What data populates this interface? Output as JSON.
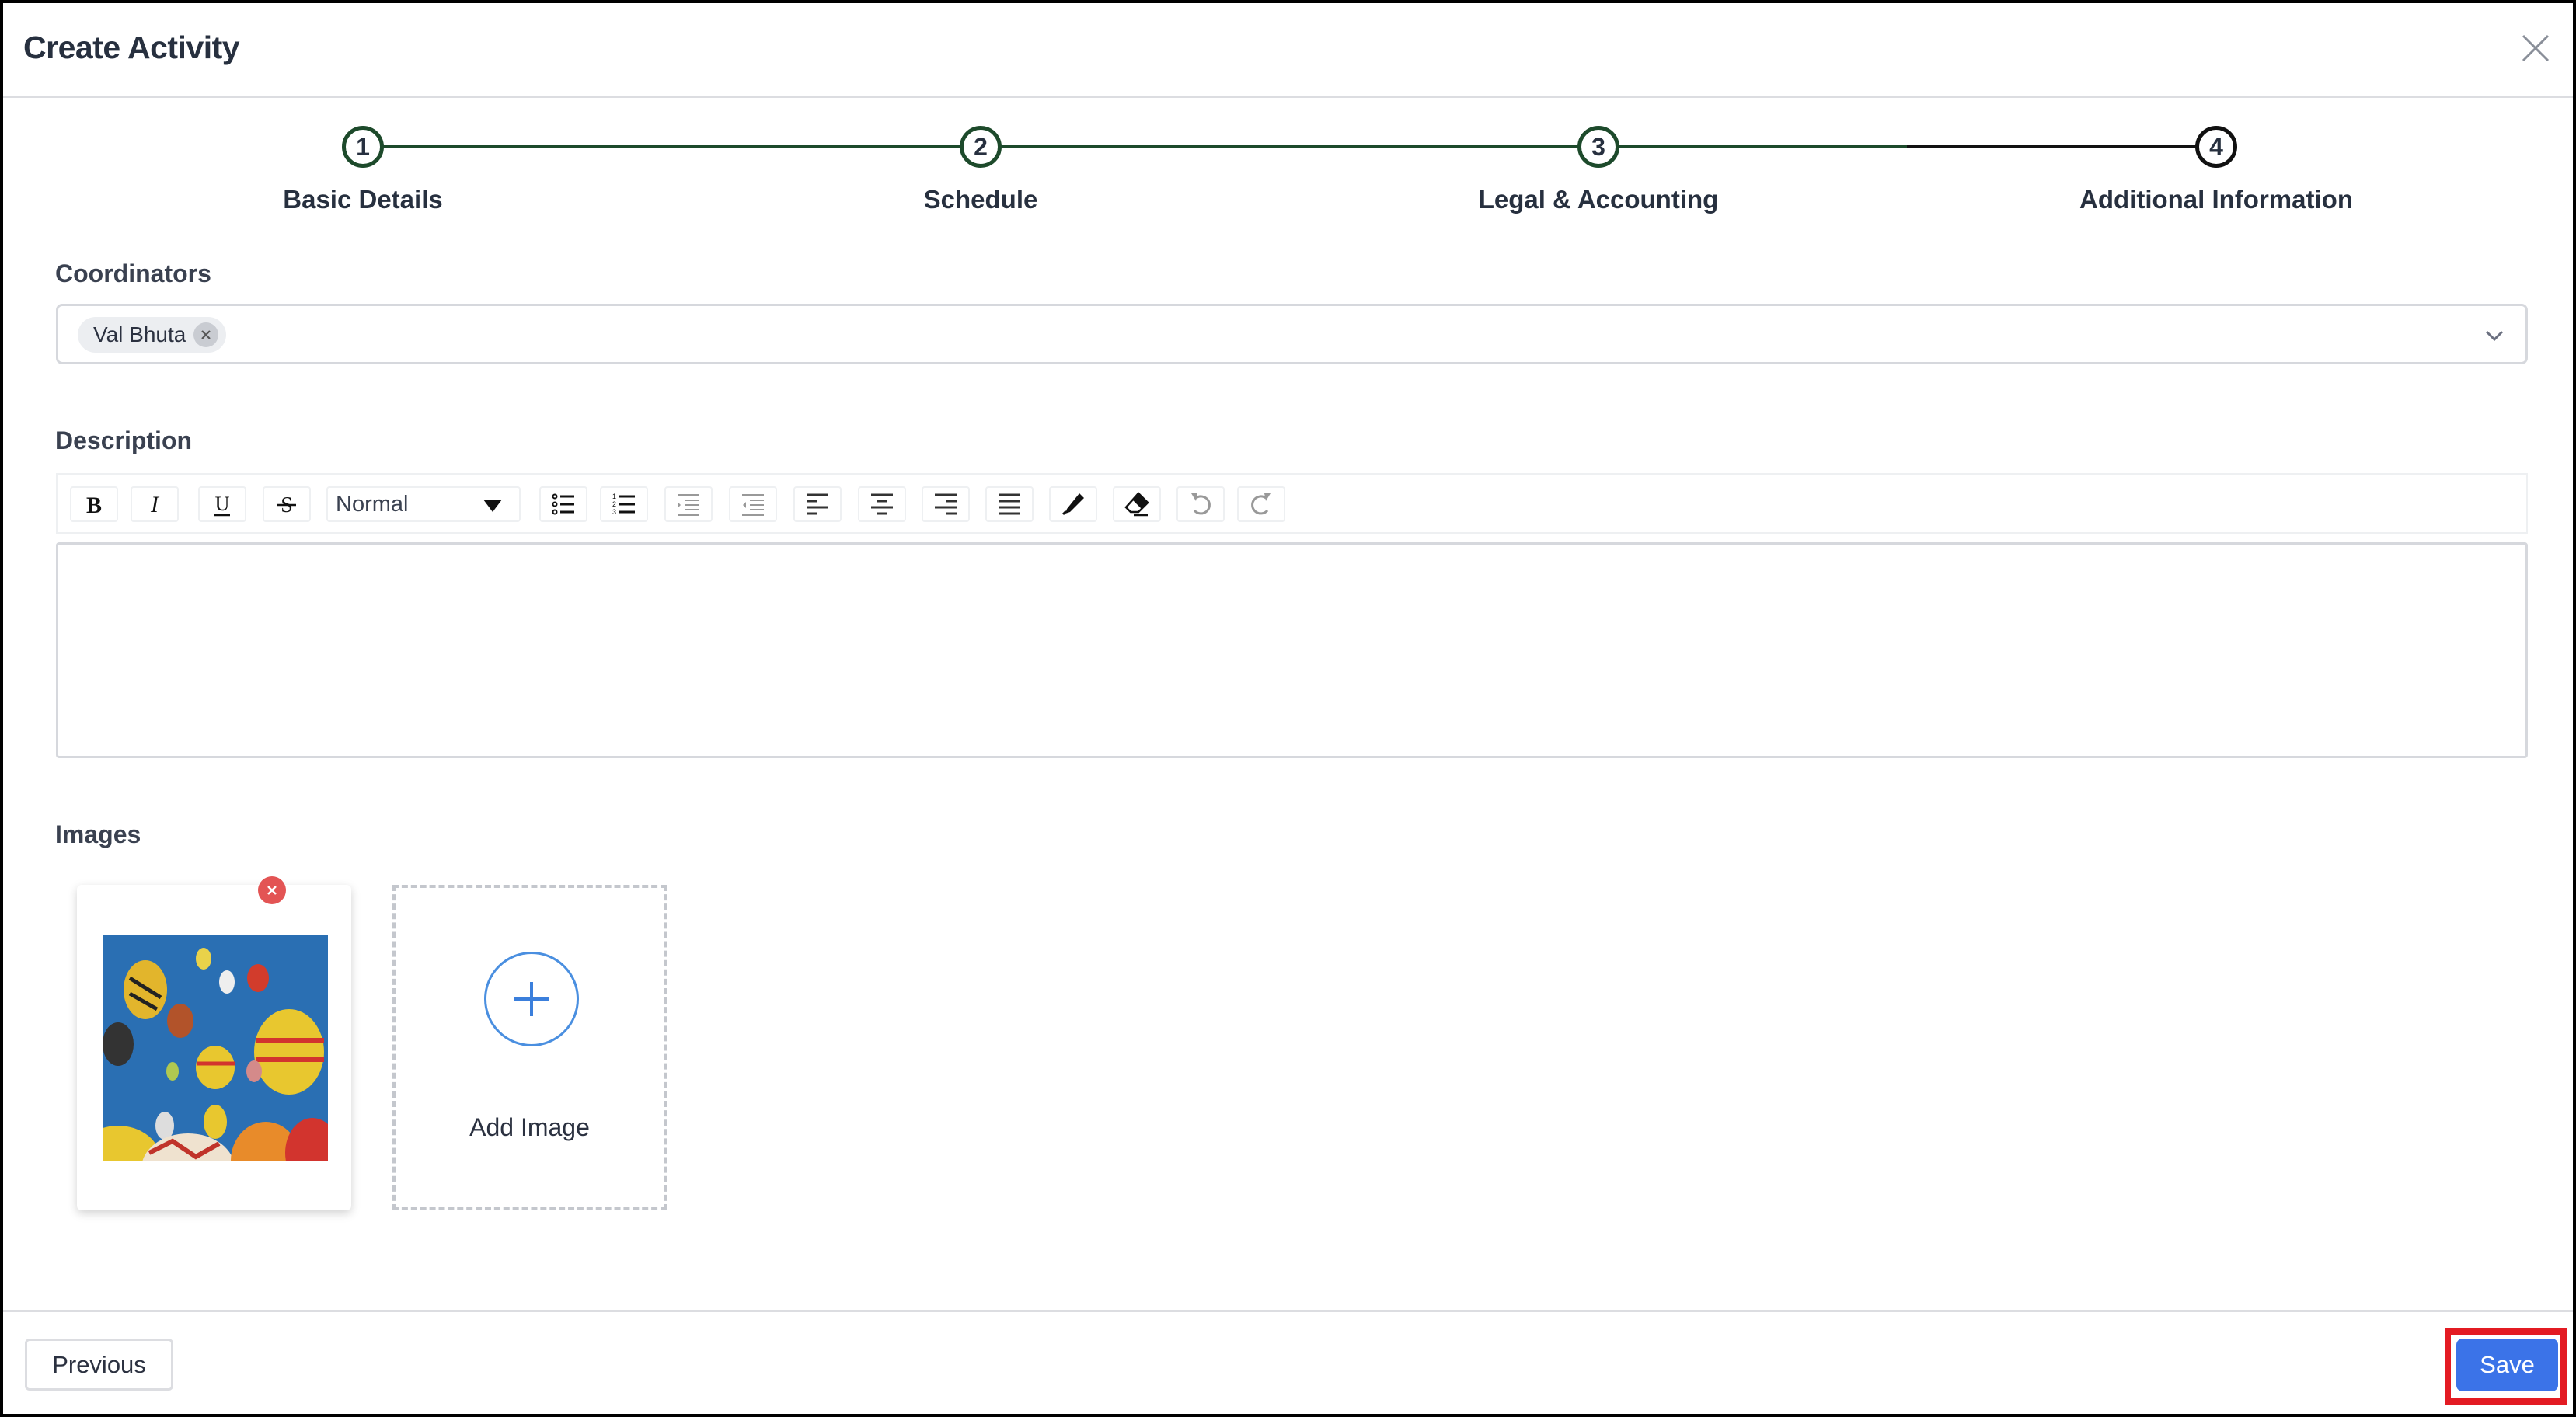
{
  "dialog": {
    "title": "Create Activity",
    "close_icon": "close-icon"
  },
  "stepper": {
    "steps": [
      {
        "number": "1",
        "label": "Basic Details",
        "state": "completed"
      },
      {
        "number": "2",
        "label": "Schedule",
        "state": "completed"
      },
      {
        "number": "3",
        "label": "Legal & Accounting",
        "state": "completed"
      },
      {
        "number": "4",
        "label": "Additional Information",
        "state": "current"
      }
    ],
    "colors": {
      "completed": "#1d4a2b",
      "current": "#111111"
    }
  },
  "coordinators": {
    "label": "Coordinators",
    "selected": [
      "Val Bhuta"
    ]
  },
  "description": {
    "label": "Description",
    "toolbar": {
      "buttons": [
        "bold",
        "italic",
        "underline",
        "strikethrough",
        "bullet-list",
        "ordered-list",
        "indent",
        "outdent",
        "align-left",
        "align-center",
        "align-right",
        "align-justify",
        "text-color",
        "clear-format",
        "undo",
        "redo"
      ],
      "format_select": "Normal"
    },
    "value": ""
  },
  "images": {
    "label": "Images",
    "items": [
      {
        "alt": "Hot air balloons"
      }
    ],
    "add_label": "Add Image"
  },
  "footer": {
    "previous_label": "Previous",
    "save_label": "Save",
    "save_color": "#3b73e8",
    "highlight_color": "#e31b23"
  }
}
